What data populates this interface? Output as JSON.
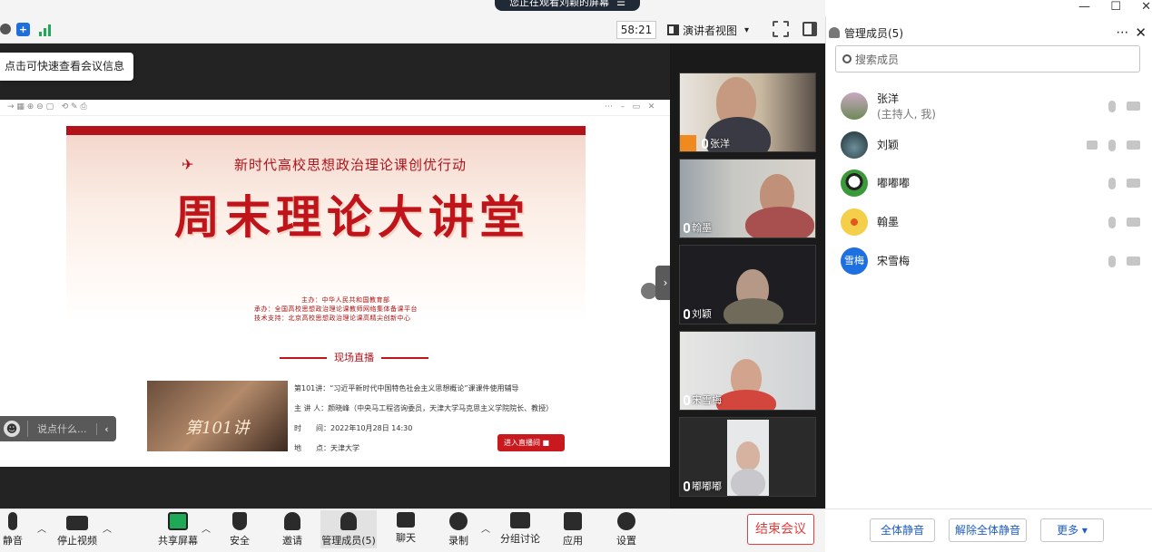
{
  "banner": {
    "text": "您正在观看刘颖的屏幕",
    "menu_icon": "menu-icon"
  },
  "topbar": {
    "timer": "58:21",
    "view_label": "演讲者视图",
    "view_caret": "▾"
  },
  "tooltip": {
    "text": "点击可快速查看会议信息"
  },
  "slide": {
    "subtitle": "新时代高校思想政治理论课创优行动",
    "title": "周末理论大讲堂",
    "org1": "主办：中华人民共和国教育部",
    "org2": "承办：全国高校思想政治理论课教师网络集体备课平台",
    "org3": "技术支持：北京高校思想政治理论课高精尖创新中心",
    "live": "现场直播",
    "lecture": "第101讲：“习近平新时代中国特色社会主义思想概论”课课件使用辅导",
    "speaker": "主 讲 人：颜晓峰（中央马工程咨询委员，天津大学马克思主义学院院长、教授）",
    "time": "时　　间：2022年10月28日 14:30",
    "place": "地　　点：天津大学",
    "thumb_text": "第101讲",
    "enter_btn": "进入直播间"
  },
  "chat": {
    "placeholder": "说点什么..."
  },
  "gallery": [
    {
      "name": "张洋",
      "host": true
    },
    {
      "name": "翰墨"
    },
    {
      "name": "刘颖"
    },
    {
      "name": "宋雪梅"
    },
    {
      "name": "嘟嘟嘟"
    }
  ],
  "panel": {
    "title": "管理成员(5)",
    "search_placeholder": "搜索成员",
    "members": [
      {
        "name": "张洋",
        "role": "(主持人, 我)",
        "avatar_color": "#8a6a7a"
      },
      {
        "name": "刘颖",
        "role": "",
        "avatar_color": "#2f4a55"
      },
      {
        "name": "嘟嘟嘟",
        "role": "",
        "avatar_color": "#3a8a3a"
      },
      {
        "name": "翰墨",
        "role": "",
        "avatar_color": "#e8b93a"
      },
      {
        "name": "宋雪梅",
        "role": "",
        "avatar_color": "#1e6fe0",
        "avatar_text": "雪梅"
      }
    ],
    "mute_all": "全体静音",
    "unmute_all": "解除全体静音",
    "more": "更多 ▾"
  },
  "toolbar": {
    "mute": "静音",
    "stop_video": "停止视频",
    "share": "共享屏幕",
    "security": "安全",
    "invite": "邀请",
    "members": "管理成员(5)",
    "chat": "聊天",
    "record": "录制",
    "breakout": "分组讨论",
    "apps": "应用",
    "settings": "设置",
    "end": "结束会议"
  },
  "colors": {
    "accent": "#1e5bc6",
    "end": "#e0403d",
    "slide_red": "#c0141b"
  }
}
